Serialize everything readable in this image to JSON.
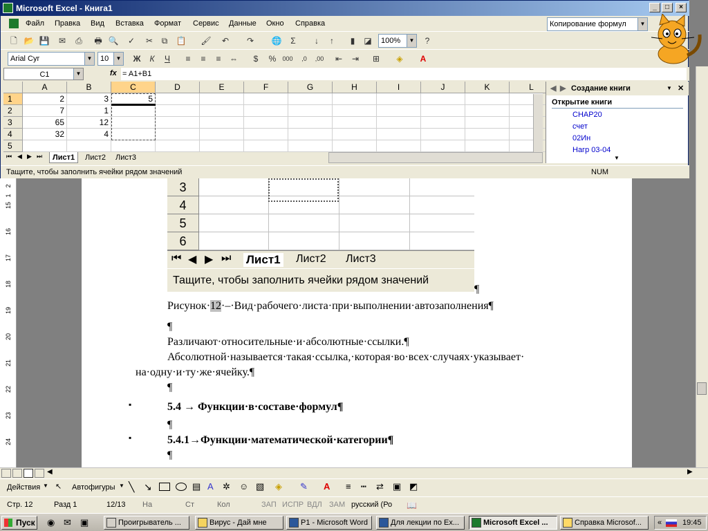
{
  "excel": {
    "title": "Microsoft Excel - Книга1",
    "menu": [
      "Файл",
      "Правка",
      "Вид",
      "Вставка",
      "Формат",
      "Сервис",
      "Данные",
      "Окно",
      "Справка"
    ],
    "help_box": "Копирование формул",
    "zoom": "100%",
    "font": "Arial Cyr",
    "font_size": "10",
    "name_box": "C1",
    "fx": "fx",
    "formula": "= A1+B1",
    "columns": [
      "A",
      "B",
      "C",
      "D",
      "E",
      "F",
      "G",
      "H",
      "I",
      "J",
      "K",
      "L"
    ],
    "rows": [
      "1",
      "2",
      "3",
      "4",
      "5"
    ],
    "cells": {
      "A": [
        "2",
        "7",
        "65",
        "32",
        ""
      ],
      "B": [
        "3",
        "1",
        "12",
        "4",
        ""
      ],
      "C": [
        "5",
        "",
        "",
        "",
        ""
      ]
    },
    "sheets": [
      "Лист1",
      "Лист2",
      "Лист3"
    ],
    "status": "Тащите, чтобы заполнить ячейки рядом значений",
    "num": "NUM",
    "pane": {
      "title": "Создание книги",
      "section": "Открытие книги",
      "links": [
        "CHAP20",
        "счет",
        "02Ин",
        "Нагр 03-04"
      ]
    }
  },
  "document": {
    "embedded": {
      "rows": [
        "3",
        "4",
        "5",
        "6"
      ],
      "sheets": [
        "Лист1",
        "Лист2",
        "Лист3"
      ],
      "status": "Тащите, чтобы заполнить ячейки рядом значений"
    },
    "pilcrow": "¶",
    "caption_pre": "Рисунок·",
    "caption_num": "12",
    "caption_post": "·–·Вид·рабочего·листа·при·выполнении·автозаполнения¶",
    "para1": "Различают·относительные·и·абсолютные·ссылки.¶",
    "para2a": "Абсолютной·называется·такая·ссылка,·которая·во·всех·случаях·указывает·",
    "para2b": "на·одну·и·ту·же·ячейку.¶",
    "heading1": "5.4 →  Функции·в·составе·формул¶",
    "heading2": "5.4.1→Функции·математической·категории¶",
    "bullet": "▪",
    "ruler": [
      "2",
      "1",
      "15",
      "16",
      "17",
      "18",
      "19",
      "20",
      "21",
      "22",
      "23",
      "24"
    ]
  },
  "word_draw": {
    "actions": "Действия",
    "autoshapes": "Автофигуры"
  },
  "word_status": {
    "page": "Стр.  12",
    "section": "Разд  1",
    "pages": "12/13",
    "at": "На",
    "line": "Ст",
    "col": "Кол",
    "rec": "ЗАП",
    "trk": "ИСПР",
    "ext": "ВДЛ",
    "ovr": "ЗАМ",
    "lang": "русский (Ро"
  },
  "taskbar": {
    "start": "Пуск",
    "tasks": [
      "Проигрыватель ...",
      "Вирус - Дай мне",
      "P1 - Microsoft Word",
      "Для лекции по Ex...",
      "Microsoft Excel ...",
      "Справка Microsof..."
    ],
    "tray_lang": "«",
    "time": "19:45"
  }
}
